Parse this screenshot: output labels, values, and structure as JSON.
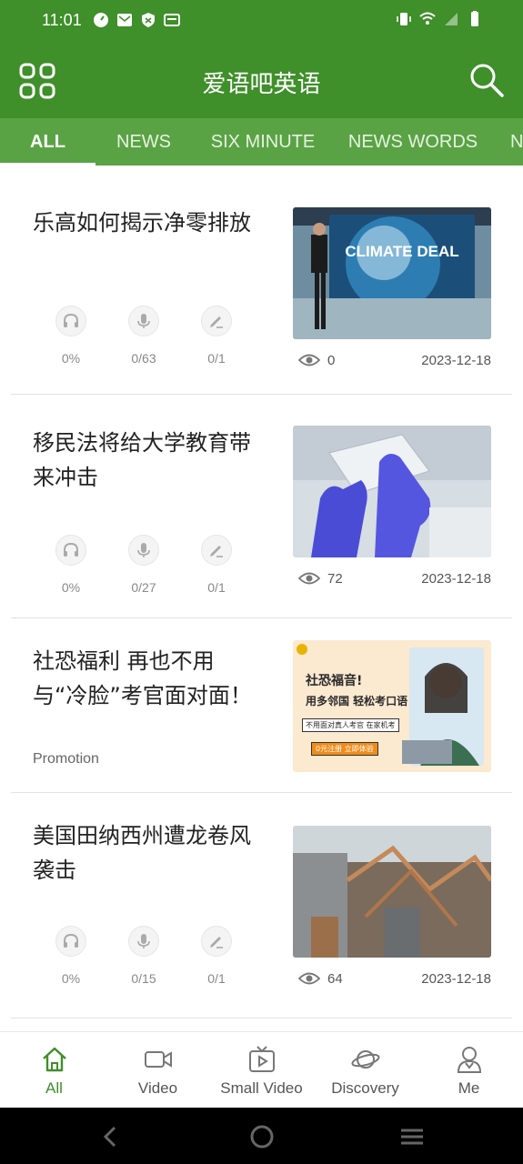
{
  "status_bar": {
    "time": "11:01",
    "icons_left": [
      "speed-icon",
      "mail-icon",
      "shield-icon",
      "card-icon"
    ],
    "icons_right": [
      "vibrate-icon",
      "wifi-icon",
      "signal-icon",
      "battery-icon"
    ]
  },
  "app_bar": {
    "title": "爱语吧英语",
    "menu_icon": "grid-menu-icon",
    "search_icon": "search-icon"
  },
  "tabs": [
    {
      "label": "ALL",
      "active": true
    },
    {
      "label": "NEWS",
      "active": false
    },
    {
      "label": "SIX MINUTE",
      "active": false
    },
    {
      "label": "NEWS WORDS",
      "active": false
    },
    {
      "label": "N",
      "active": false
    }
  ],
  "articles": [
    {
      "title": "乐高如何揭示净零排放",
      "listen": "0%",
      "record": "0/63",
      "exercise": "0/1",
      "views": "0",
      "date": "2023-12-18",
      "thumb_caption": "CLIMATE DEAL"
    },
    {
      "title": "移民法将给大学教育带来冲击",
      "listen": "0%",
      "record": "0/27",
      "exercise": "0/1",
      "views": "72",
      "date": "2023-12-18"
    },
    {
      "title": "社恐福利 再也不用与“冷脸”考官面对面！",
      "promo_label": "Promotion",
      "ad_lines": [
        "社恐福音!",
        "用多邻国 轻松考口语",
        "不用面对真人考官 在家机考",
        "0元注册 立即体验"
      ]
    },
    {
      "title": "美国田纳西州遭龙卷风袭击",
      "listen": "0%",
      "record": "0/15",
      "exercise": "0/1",
      "views": "64",
      "date": "2023-12-18"
    }
  ],
  "bottom_nav": [
    {
      "label": "All",
      "icon": "home-icon",
      "active": true
    },
    {
      "label": "Video",
      "icon": "video-camera-icon",
      "active": false
    },
    {
      "label": "Small Video",
      "icon": "tv-play-icon",
      "active": false
    },
    {
      "label": "Discovery",
      "icon": "planet-icon",
      "active": false
    },
    {
      "label": "Me",
      "icon": "person-icon",
      "active": false
    }
  ],
  "colors": {
    "primary": "#3f8f2a",
    "tab_bar": "#5aa344",
    "active_nav": "#3f8f2a"
  }
}
